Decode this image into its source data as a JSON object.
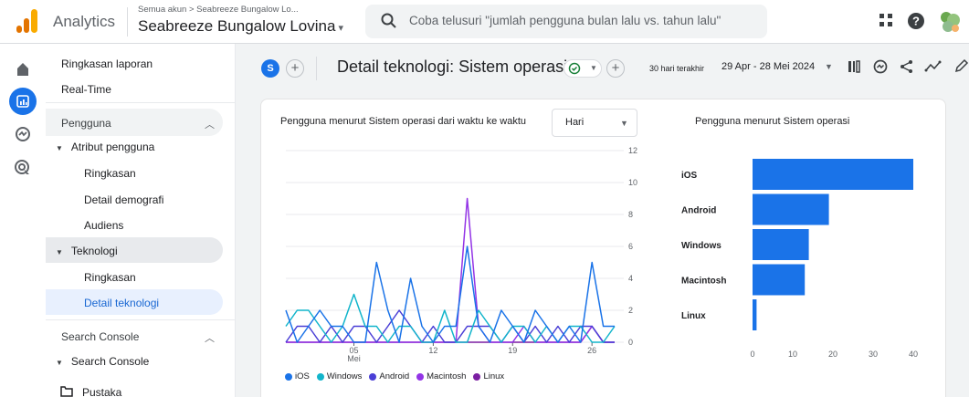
{
  "header": {
    "app_name": "Analytics",
    "breadcrumb": "Semua akun > Seabreeze Bungalow Lo...",
    "property": "Seabreeze Bungalow Lovina",
    "search_placeholder": "Coba telusuri \"jumlah pengguna bulan lalu vs. tahun lalu\""
  },
  "nav": {
    "report_summary": "Ringkasan laporan",
    "realtime": "Real-Time",
    "section_users": "Pengguna",
    "user_attributes": "Atribut pengguna",
    "ua_overview": "Ringkasan",
    "ua_demographics": "Detail demografi",
    "ua_audiences": "Audiens",
    "technology": "Teknologi",
    "tech_overview": "Ringkasan",
    "tech_detail": "Detail teknologi",
    "section_search_console": "Search Console",
    "search_console_group": "Search Console",
    "library": "Pustaka"
  },
  "toolbar": {
    "segment_badge": "S",
    "page_title": "Detail teknologi: Sistem operasi",
    "date_hint": "30 hari terakhir",
    "date_range": "29 Apr - 28 Mei 2024"
  },
  "line_card": {
    "title": "Pengguna menurut Sistem operasi dari waktu ke waktu",
    "granularity": "Hari"
  },
  "bar_card": {
    "title": "Pengguna menurut Sistem operasi"
  },
  "colors": {
    "iOS": "#1a73e8",
    "Windows": "#12b5cb",
    "Android": "#4a3fd6",
    "Macintosh": "#9334e6",
    "Linux": "#7b1fa2"
  },
  "chart_data": [
    {
      "type": "line",
      "x": [
        "29 Apr",
        "30 Apr",
        "1 Mei",
        "2 Mei",
        "3 Mei",
        "4 Mei",
        "5 Mei",
        "6 Mei",
        "7 Mei",
        "8 Mei",
        "9 Mei",
        "10 Mei",
        "11 Mei",
        "12 Mei",
        "13 Mei",
        "14 Mei",
        "15 Mei",
        "16 Mei",
        "17 Mei",
        "18 Mei",
        "19 Mei",
        "20 Mei",
        "21 Mei",
        "22 Mei",
        "23 Mei",
        "24 Mei",
        "25 Mei",
        "26 Mei",
        "27 Mei",
        "28 Mei"
      ],
      "x_ticks": [
        {
          "label": "05",
          "sub": "Mei",
          "index": 6
        },
        {
          "label": "12",
          "sub": "",
          "index": 13
        },
        {
          "label": "19",
          "sub": "",
          "index": 20
        },
        {
          "label": "26",
          "sub": "",
          "index": 27
        }
      ],
      "y_ticks": [
        0,
        2,
        4,
        6,
        8,
        10,
        12
      ],
      "ylim": [
        0,
        12
      ],
      "series": [
        {
          "name": "iOS",
          "values": [
            2,
            0,
            1,
            2,
            1,
            1,
            0,
            0,
            5,
            2,
            0,
            4,
            1,
            0,
            1,
            1,
            6,
            1,
            0,
            2,
            1,
            0,
            2,
            1,
            0,
            1,
            0,
            5,
            1,
            1
          ]
        },
        {
          "name": "Windows",
          "values": [
            1,
            2,
            2,
            1,
            0,
            1,
            3,
            1,
            1,
            0,
            1,
            1,
            0,
            0,
            2,
            0,
            0,
            2,
            1,
            0,
            1,
            1,
            0,
            1,
            0,
            1,
            1,
            0,
            0,
            1
          ]
        },
        {
          "name": "Android",
          "values": [
            0,
            1,
            1,
            0,
            1,
            0,
            1,
            1,
            0,
            1,
            2,
            1,
            0,
            1,
            0,
            0,
            1,
            1,
            1,
            0,
            1,
            0,
            1,
            0,
            1,
            0,
            1,
            1,
            0,
            0
          ]
        },
        {
          "name": "Macintosh",
          "values": [
            0,
            0,
            0,
            0,
            0,
            0,
            0,
            0,
            0,
            0,
            0,
            0,
            0,
            0,
            0,
            0,
            9,
            1,
            0,
            0,
            0,
            1,
            0,
            0,
            0,
            0,
            0,
            1,
            0,
            0
          ]
        },
        {
          "name": "Linux",
          "values": [
            0,
            0,
            0,
            0,
            0,
            0,
            0,
            0,
            0,
            0,
            0,
            0,
            0,
            0,
            0,
            0,
            0,
            0,
            0,
            0,
            0,
            0,
            0,
            0,
            0,
            0,
            0,
            1,
            0,
            0
          ]
        }
      ]
    },
    {
      "type": "bar",
      "orientation": "horizontal",
      "categories": [
        "iOS",
        "Android",
        "Windows",
        "Macintosh",
        "Linux"
      ],
      "values": [
        40,
        19,
        14,
        13,
        1
      ],
      "x_ticks": [
        0,
        10,
        20,
        30,
        40
      ],
      "xlim": [
        0,
        40
      ]
    }
  ]
}
